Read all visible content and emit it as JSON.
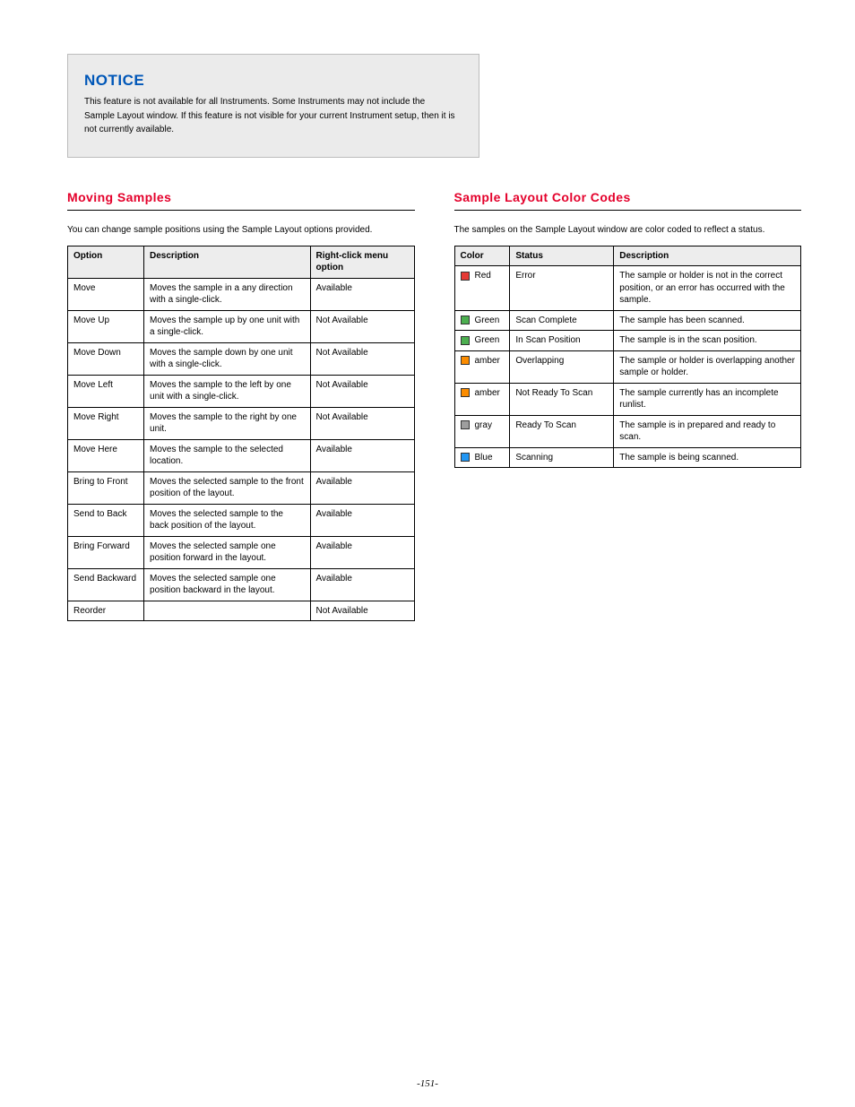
{
  "notice": {
    "heading": "NOTICE",
    "body": "This feature is not available for all Instruments. Some Instruments may not include the Sample Layout window. If this feature is not visible for your current Instrument setup, then it is not currently available."
  },
  "left": {
    "title": "Moving Samples",
    "intro": "You can change sample positions using the Sample Layout options provided.",
    "table": {
      "headers": [
        "Option",
        "Description",
        "Right-click menu option"
      ],
      "rows": [
        {
          "opt": "Move",
          "desc": "Moves the sample in a any direction with a single-click.",
          "rc": "Available"
        },
        {
          "opt": "Move Up",
          "desc": "Moves the sample up by one unit with a single-click.",
          "rc": "Not Available"
        },
        {
          "opt": "Move Down",
          "desc": "Moves the sample down by one unit with a single-click.",
          "rc": "Not Available"
        },
        {
          "opt": "Move Left",
          "desc": "Moves the sample to the left by one unit with a single-click.",
          "rc": "Not Available"
        },
        {
          "opt": "Move Right",
          "desc": "Moves the sample to the right by one unit.",
          "rc": "Not Available"
        },
        {
          "opt": "Move Here",
          "desc": "Moves the sample to the selected location.",
          "rc": "Available"
        },
        {
          "opt": "Bring to Front",
          "desc": "Moves the selected sample to the front position of the layout.",
          "rc": "Available"
        },
        {
          "opt": "Send to Back",
          "desc": "Moves the selected sample to the back position of the layout.",
          "rc": "Available"
        },
        {
          "opt": "Bring Forward",
          "desc": "Moves the selected sample one position forward in the layout.",
          "rc": "Available"
        },
        {
          "opt": "Send Backward",
          "desc": "Moves the selected sample one position backward in the layout.",
          "rc": "Available"
        },
        {
          "opt": "Reorder",
          "desc": "",
          "rc": "Not Available"
        }
      ]
    }
  },
  "right": {
    "title": "Sample Layout Color Codes",
    "intro": "The samples on the Sample Layout window are color coded to reflect a status.",
    "table": {
      "headers": [
        "Color",
        "Status",
        "Description"
      ],
      "rows": [
        {
          "color": "red",
          "colorText": "Red",
          "status": "Error",
          "desc": "The sample or holder is not in the correct position, or an error has occurred with the sample."
        },
        {
          "color": "green",
          "colorText": "Green",
          "status": "Scan Complete",
          "desc": "The sample has been scanned."
        },
        {
          "color": "green",
          "colorText": "Green",
          "status": "In Scan Position",
          "desc": "The sample is in the scan position."
        },
        {
          "color": "orange",
          "colorText": "amber",
          "status": "Overlapping",
          "desc": "The sample or holder is overlapping another sample or holder."
        },
        {
          "color": "orange",
          "colorText": "amber",
          "status": "Not Ready To Scan",
          "desc": "The sample currently has an incomplete runlist."
        },
        {
          "color": "gray",
          "colorText": "gray",
          "status": "Ready To Scan",
          "desc": "The sample is in prepared and ready to scan."
        },
        {
          "color": "blue",
          "colorText": "Blue",
          "status": "Scanning",
          "desc": "The sample is being scanned."
        }
      ]
    }
  },
  "footer": "-151-"
}
